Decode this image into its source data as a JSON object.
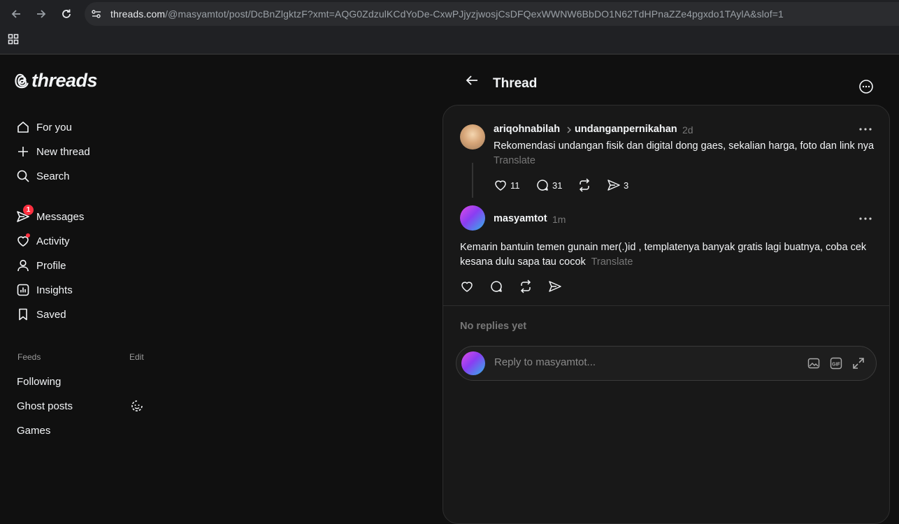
{
  "browser": {
    "url_host": "threads.com",
    "url_path": "/@masyamtot/post/DcBnZlgktzF?xmt=AQG0ZdzulKCdYoDe-CxwPJjyzjwosjCsDFQexWWNW6BbDO1N62TdHPnaZZe4pgxdo1TAylA&slof=1"
  },
  "logo": {
    "text": "threads"
  },
  "nav": {
    "for_you": "For you",
    "new_thread": "New thread",
    "search": "Search",
    "messages": "Messages",
    "messages_badge": "1",
    "activity": "Activity",
    "profile": "Profile",
    "insights": "Insights",
    "saved": "Saved"
  },
  "feeds": {
    "header": "Feeds",
    "edit": "Edit",
    "items": [
      "Following",
      "Ghost posts",
      "Games"
    ]
  },
  "header": {
    "title": "Thread"
  },
  "parent_post": {
    "username": "ariqohnabilah",
    "topic": "undanganpernikahan",
    "time": "2d",
    "text": "Rekomendasi undangan fisik dan digital dong gaes, sekalian harga, foto dan link nya",
    "translate": "Translate",
    "likes": "11",
    "replies": "31",
    "shares": "3"
  },
  "reply_post": {
    "username": "masyamtot",
    "time": "1m",
    "text": "Kemarin bantuin temen gunain mer(.)id , templatenya banyak gratis lagi buatnya, coba cek kesana dulu sapa tau cocok",
    "translate": "Translate"
  },
  "no_replies": "No replies yet",
  "reply_box": {
    "placeholder": "Reply to masyamtot..."
  },
  "colors": {
    "background": "#101010",
    "card": "#181818",
    "badge": "#ff3040",
    "muted": "#777777"
  }
}
